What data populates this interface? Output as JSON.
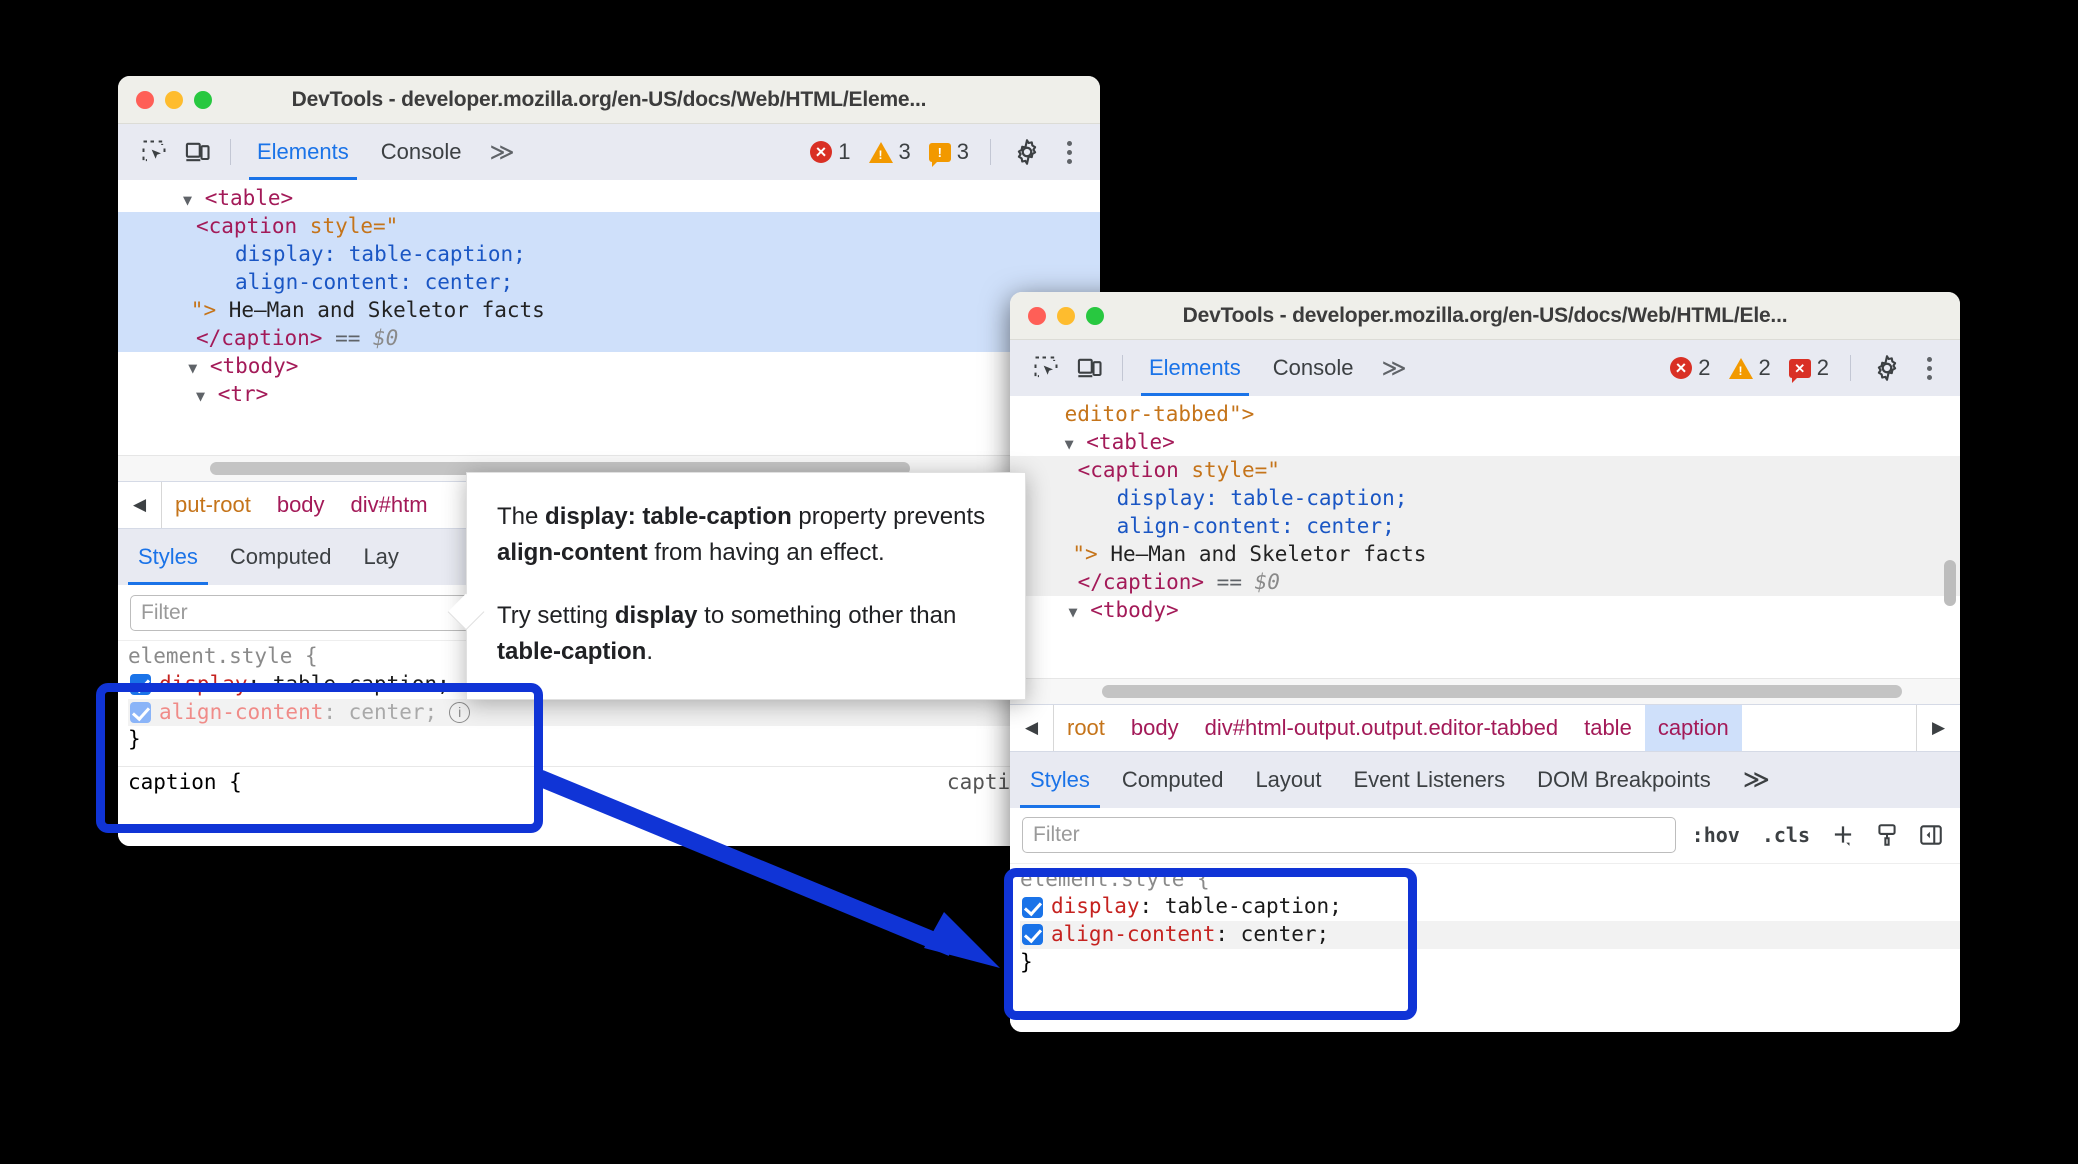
{
  "window1": {
    "title": "DevTools - developer.mozilla.org/en-US/docs/Web/HTML/Eleme...",
    "toolbar": {
      "tabs": [
        {
          "label": "Elements",
          "active": true
        },
        {
          "label": "Console",
          "active": false
        }
      ],
      "more_label": "≫",
      "errors": "1",
      "warnings": "3",
      "issues": "3",
      "settings_icon": "gear-icon",
      "menu_icon": "kebab-menu-icon",
      "inspect_icon": "inspect-element-icon",
      "device_icon": "device-toolbar-icon"
    },
    "dom": [
      {
        "indent": 5,
        "triangle": true,
        "parts": [
          {
            "t": "tag",
            "s": "<table>"
          }
        ],
        "selection": "none"
      },
      {
        "indent": 6,
        "triangle": false,
        "parts": [
          {
            "t": "tag",
            "s": "<caption "
          },
          {
            "t": "attr",
            "s": "style=\""
          }
        ],
        "selection": "blue"
      },
      {
        "indent": 9,
        "triangle": false,
        "parts": [
          {
            "t": "css",
            "s": "display: table-caption;"
          }
        ],
        "selection": "blue"
      },
      {
        "indent": 9,
        "triangle": false,
        "parts": [
          {
            "t": "css",
            "s": "align-content: center;"
          }
        ],
        "selection": "blue"
      },
      {
        "indent": 5.6,
        "triangle": false,
        "parts": [
          {
            "t": "attr",
            "s": "\">"
          },
          {
            "t": "txt",
            "s": " He–Man and Skeletor facts"
          }
        ],
        "selection": "blue"
      },
      {
        "indent": 6,
        "triangle": false,
        "parts": [
          {
            "t": "tag",
            "s": "</caption>"
          },
          {
            "t": "eq",
            "s": " == "
          },
          {
            "t": "dollar",
            "s": "$0"
          }
        ],
        "selection": "blue"
      },
      {
        "indent": 5.4,
        "triangle": true,
        "parts": [
          {
            "t": "tag",
            "s": "<tbody>"
          }
        ],
        "selection": "none"
      },
      {
        "indent": 6,
        "triangle": true,
        "parts": [
          {
            "t": "tag",
            "s": "<tr>"
          }
        ],
        "selection": "none"
      }
    ],
    "breadcrumb": {
      "back_icon": "chevron-left-icon",
      "items": [
        {
          "label": "put-root",
          "color": "orange",
          "active": false
        },
        {
          "label": "body",
          "color": "magenta",
          "active": false
        },
        {
          "label": "div#htm",
          "color": "magenta",
          "active": false
        }
      ]
    },
    "sidebar_tabs": [
      {
        "label": "Styles",
        "active": true
      },
      {
        "label": "Computed",
        "active": false
      },
      {
        "label": "Lay",
        "active": false
      }
    ],
    "filter_placeholder": "Filter",
    "styles": {
      "rule_header": "element.style {",
      "rule_close": "}",
      "declarations": [
        {
          "checked": true,
          "dimmed": false,
          "prop": "display",
          "value": "table-caption;",
          "info": false
        },
        {
          "checked": true,
          "dimmed": true,
          "prop": "align-content",
          "value": "center;",
          "info": true
        }
      ],
      "next_rule_selector": "caption {",
      "next_rule_source": "caption.htm"
    }
  },
  "window2": {
    "title": "DevTools - developer.mozilla.org/en-US/docs/Web/HTML/Ele...",
    "toolbar": {
      "tabs": [
        {
          "label": "Elements",
          "active": true
        },
        {
          "label": "Console",
          "active": false
        }
      ],
      "more_label": "≫",
      "errors": "2",
      "warnings": "2",
      "issues": "2",
      "settings_icon": "gear-icon",
      "menu_icon": "kebab-menu-icon",
      "inspect_icon": "inspect-element-icon",
      "device_icon": "device-toolbar-icon"
    },
    "dom": [
      {
        "indent": 4.2,
        "triangle": false,
        "parts": [
          {
            "t": "attr",
            "s": "editor-tabbed\">"
          }
        ],
        "selection": "none"
      },
      {
        "indent": 4.2,
        "triangle": true,
        "parts": [
          {
            "t": "tag",
            "s": "<table>"
          }
        ],
        "selection": "none"
      },
      {
        "indent": 5.2,
        "triangle": false,
        "parts": [
          {
            "t": "tag",
            "s": "<caption "
          },
          {
            "t": "attr",
            "s": "style=\""
          }
        ],
        "selection": "grey"
      },
      {
        "indent": 8.2,
        "triangle": false,
        "parts": [
          {
            "t": "css",
            "s": "display: table-caption;"
          }
        ],
        "selection": "grey"
      },
      {
        "indent": 8.2,
        "triangle": false,
        "parts": [
          {
            "t": "css",
            "s": "align-content: center;"
          }
        ],
        "selection": "grey"
      },
      {
        "indent": 4.8,
        "triangle": false,
        "parts": [
          {
            "t": "attr",
            "s": "\">"
          },
          {
            "t": "txt",
            "s": " He–Man and Skeletor facts"
          }
        ],
        "selection": "grey"
      },
      {
        "indent": 5.2,
        "triangle": false,
        "parts": [
          {
            "t": "tag",
            "s": "</caption>"
          },
          {
            "t": "eq",
            "s": " == "
          },
          {
            "t": "dollar",
            "s": "$0"
          }
        ],
        "selection": "grey"
      },
      {
        "indent": 4.5,
        "triangle": true,
        "parts": [
          {
            "t": "tag",
            "s": "<tbody>"
          }
        ],
        "selection": "none"
      }
    ],
    "breadcrumb": {
      "back_icon": "chevron-left-icon",
      "forward_icon": "chevron-right-icon",
      "items": [
        {
          "label": "root",
          "color": "orange",
          "active": false
        },
        {
          "label": "body",
          "color": "magenta",
          "active": false
        },
        {
          "label": "div#html-output.output.editor-tabbed",
          "color": "magenta",
          "active": false
        },
        {
          "label": "table",
          "color": "magenta",
          "active": false
        },
        {
          "label": "caption",
          "color": "magenta",
          "active": true
        }
      ]
    },
    "sidebar_tabs": [
      {
        "label": "Styles",
        "active": true
      },
      {
        "label": "Computed",
        "active": false
      },
      {
        "label": "Layout",
        "active": false
      },
      {
        "label": "Event Listeners",
        "active": false
      },
      {
        "label": "DOM Breakpoints",
        "active": false
      }
    ],
    "sidebar_more": "≫",
    "filter_placeholder": "Filter",
    "filter_tools": {
      "hov": ":hov",
      "cls": ".cls",
      "add_icon": "plus-new-style-rule-icon",
      "paint_icon": "color-picker-icon",
      "panel_icon": "toggle-sidebar-icon"
    },
    "styles": {
      "rule_header": "element.style {",
      "rule_close": "}",
      "declarations": [
        {
          "checked": true,
          "dimmed": false,
          "prop": "display",
          "value": "table-caption;",
          "info": false
        },
        {
          "checked": true,
          "dimmed": false,
          "prop": "align-content",
          "value": "center;",
          "info": false
        }
      ]
    }
  },
  "tooltip": {
    "p1_a": "The ",
    "p1_b": "display: table-caption",
    "p1_c": " property prevents ",
    "p1_d": "align-content",
    "p1_e": " from having an effect.",
    "p2_a": "Try setting ",
    "p2_b": "display",
    "p2_c": " to something other than ",
    "p2_d": "table-caption",
    "p2_e": "."
  },
  "annotation": {
    "color": "#1034d6",
    "box1_name": "highlight-box-window1-element-style",
    "box2_name": "highlight-box-window2-element-style",
    "arrow_name": "annotation-arrow"
  }
}
